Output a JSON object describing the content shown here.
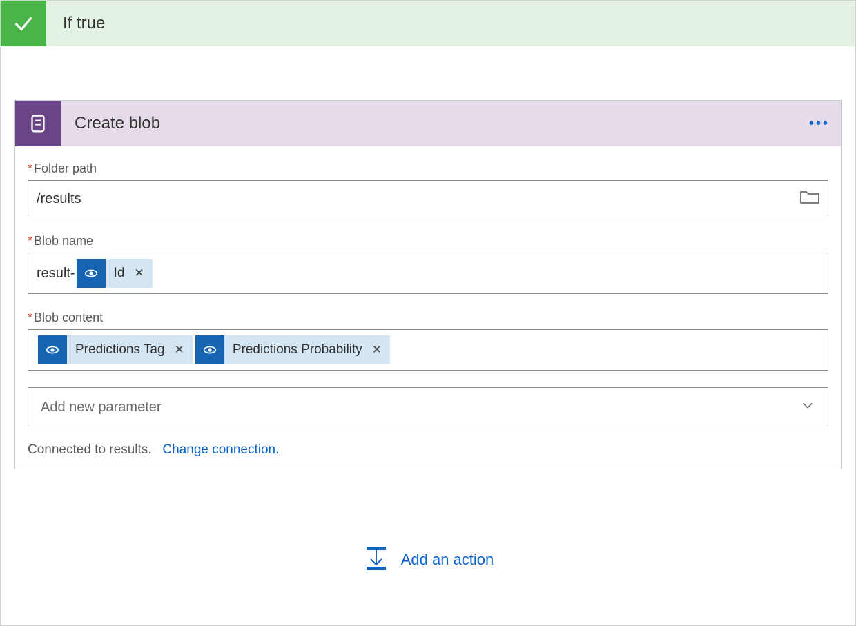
{
  "header": {
    "title": "If true"
  },
  "card": {
    "title": "Create blob",
    "fields": {
      "folderPath": {
        "label": "Folder path",
        "value": "/results"
      },
      "blobName": {
        "label": "Blob name",
        "prefix": "result-",
        "tokens": [
          {
            "label": "Id"
          }
        ]
      },
      "blobContent": {
        "label": "Blob content",
        "tokens": [
          {
            "label": "Predictions Tag"
          },
          {
            "label": "Predictions Probability"
          }
        ]
      }
    },
    "addParameterPlaceholder": "Add new parameter",
    "connection": {
      "text": "Connected to results.",
      "link": "Change connection."
    }
  },
  "addAction": {
    "label": "Add an action"
  }
}
